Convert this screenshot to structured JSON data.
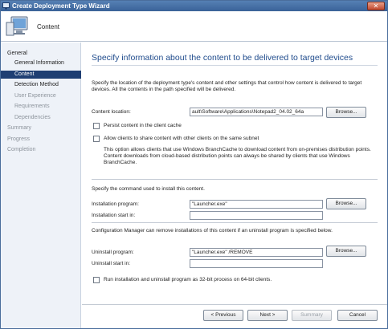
{
  "window": {
    "title": "Create Deployment Type Wizard",
    "close_glyph": "✕"
  },
  "header": {
    "page_name": "Content",
    "icon": "monitor-icon"
  },
  "nav": {
    "items": [
      {
        "label": "General",
        "state": "normal"
      },
      {
        "label": "General Information",
        "state": "normal"
      },
      {
        "label": "Content",
        "state": "active"
      },
      {
        "label": "Detection Method",
        "state": "normal"
      },
      {
        "label": "User Experience",
        "state": "disabled"
      },
      {
        "label": "Requirements",
        "state": "disabled"
      },
      {
        "label": "Dependencies",
        "state": "disabled"
      },
      {
        "label": "Summary",
        "state": "disabled"
      },
      {
        "label": "Progress",
        "state": "disabled"
      },
      {
        "label": "Completion",
        "state": "disabled"
      }
    ]
  },
  "main": {
    "heading": "Specify information about the content to be delivered to target devices",
    "intro": "Specify the location of the deployment type's content and other settings that control how content is delivered to target devices. All the contents in the path specified will be delivered.",
    "content_location_label": "Content location:",
    "content_location_value": "ault\\Software\\Applications\\Notepad2_04.02_64a",
    "browse_label": "Browse...",
    "persist_label": "Persist content in the client cache",
    "share_label": "Allow clients to share content with other clients on the same subnet",
    "branchcache_note": "This option allows clients that use Windows BranchCache to download content from on-premises distribution points. Content downloads from cloud-based distribution points can always be shared by clients that use Windows BranchCache.",
    "command_intro": "Specify the command used to install this content.",
    "install_program_label": "Installation program:",
    "install_program_value": "\"Launcher.exe\"",
    "install_start_label": "Installation start in:",
    "install_start_value": "",
    "uninstall_intro": "Configuration Manager can remove installations of this content if an uninstall program is specified below.",
    "uninstall_program_label": "Uninstall program:",
    "uninstall_program_value": "\"Launcher.exe\" /REMOVE",
    "uninstall_start_label": "Uninstall start in:",
    "uninstall_start_value": "",
    "run32_label": "Run installation and uninstall program as 32-bit process on 64-bit clients."
  },
  "footer": {
    "previous_label": "< Previous",
    "next_label": "Next >",
    "summary_label": "Summary",
    "cancel_label": "Cancel"
  },
  "colors": {
    "title_bar": "#3a6298",
    "nav_active": "#1f3f73",
    "heading": "#1f4b8c"
  }
}
